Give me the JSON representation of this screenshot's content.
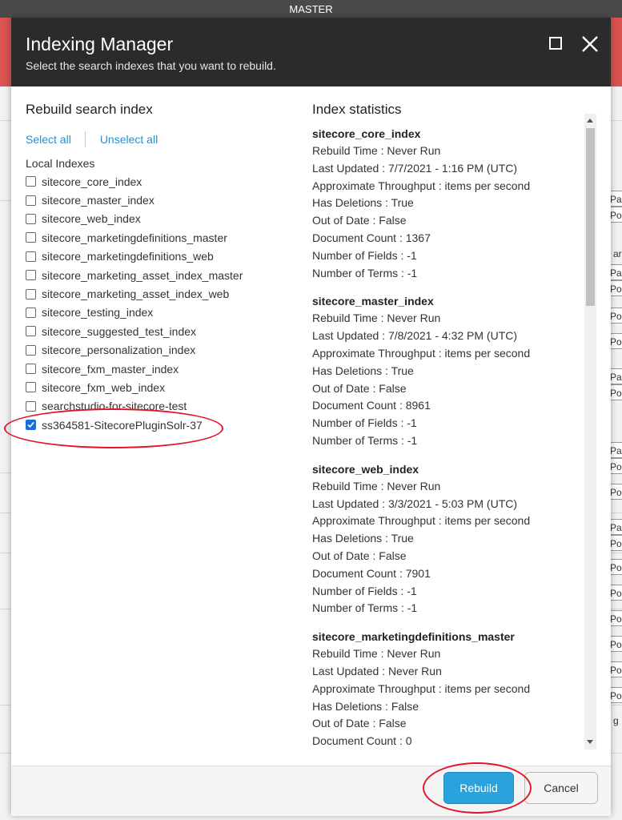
{
  "app": {
    "top_bar_title": "MASTER"
  },
  "background_chips": [
    "Pa",
    "Po",
    "Pa",
    "Po",
    "Po",
    "Po",
    "Pa",
    "Po",
    "Pa",
    "Po",
    "Po",
    "Pa",
    "Po",
    "Po",
    "Po",
    "Po",
    "Po",
    "Po",
    "Po"
  ],
  "background_texts": [
    "ar",
    "g"
  ],
  "dialog": {
    "title": "Indexing Manager",
    "subtitle": "Select the search indexes that you want to rebuild.",
    "maximize_icon": "maximize-icon",
    "close_icon": "close-icon",
    "left": {
      "heading": "Rebuild search index",
      "select_all": "Select all",
      "unselect_all": "Unselect all",
      "group_label": "Local Indexes",
      "indexes": [
        {
          "label": "sitecore_core_index",
          "checked": false
        },
        {
          "label": "sitecore_master_index",
          "checked": false
        },
        {
          "label": "sitecore_web_index",
          "checked": false
        },
        {
          "label": "sitecore_marketingdefinitions_master",
          "checked": false
        },
        {
          "label": "sitecore_marketingdefinitions_web",
          "checked": false
        },
        {
          "label": "sitecore_marketing_asset_index_master",
          "checked": false
        },
        {
          "label": "sitecore_marketing_asset_index_web",
          "checked": false
        },
        {
          "label": "sitecore_testing_index",
          "checked": false
        },
        {
          "label": "sitecore_suggested_test_index",
          "checked": false
        },
        {
          "label": "sitecore_personalization_index",
          "checked": false
        },
        {
          "label": "sitecore_fxm_master_index",
          "checked": false
        },
        {
          "label": "sitecore_fxm_web_index",
          "checked": false
        },
        {
          "label": "searchstudio-for-sitecore-test",
          "checked": false
        },
        {
          "label": "ss364581-SitecorePluginSolr-37",
          "checked": true
        }
      ]
    },
    "right": {
      "heading": "Index statistics",
      "stats": [
        {
          "name": "sitecore_core_index",
          "lines": [
            "Rebuild Time : Never Run",
            "Last Updated : 7/7/2021 - 1:16 PM (UTC)",
            "Approximate Throughput : items per second",
            "Has Deletions : True",
            "Out of Date : False",
            "Document Count : 1367",
            "Number of Fields : -1",
            "Number of Terms : -1"
          ]
        },
        {
          "name": "sitecore_master_index",
          "lines": [
            "Rebuild Time : Never Run",
            "Last Updated : 7/8/2021 - 4:32 PM (UTC)",
            "Approximate Throughput : items per second",
            "Has Deletions : True",
            "Out of Date : False",
            "Document Count : 8961",
            "Number of Fields : -1",
            "Number of Terms : -1"
          ]
        },
        {
          "name": "sitecore_web_index",
          "lines": [
            "Rebuild Time : Never Run",
            "Last Updated : 3/3/2021 - 5:03 PM (UTC)",
            "Approximate Throughput : items per second",
            "Has Deletions : True",
            "Out of Date : False",
            "Document Count : 7901",
            "Number of Fields : -1",
            "Number of Terms : -1"
          ]
        },
        {
          "name": "sitecore_marketingdefinitions_master",
          "lines": [
            "Rebuild Time : Never Run",
            "Last Updated : Never Run",
            "Approximate Throughput : items per second",
            "Has Deletions : False",
            "Out of Date : False",
            "Document Count : 0"
          ]
        }
      ]
    },
    "footer": {
      "rebuild_label": "Rebuild",
      "cancel_label": "Cancel"
    }
  },
  "colors": {
    "accent": "#2aa3dc",
    "header": "#2b2b2b",
    "annotation": "#e2162a",
    "link": "#2a8fc7"
  }
}
